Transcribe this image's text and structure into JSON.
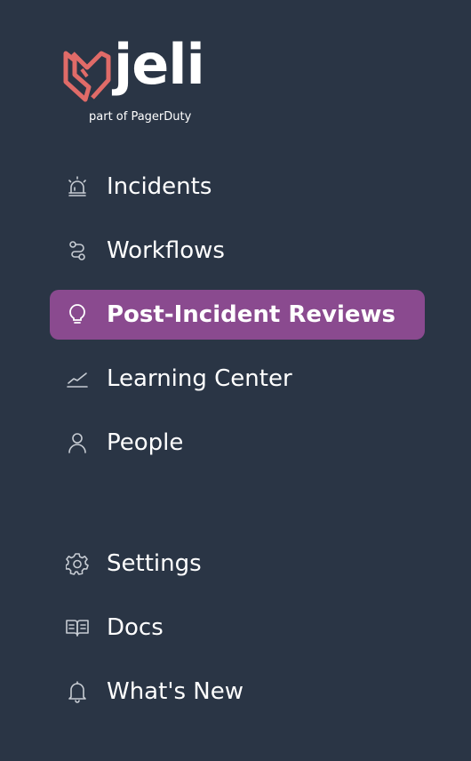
{
  "brand": {
    "name": "jeli",
    "tagline": "part of PagerDuty",
    "logo_color": "#e06b68"
  },
  "colors": {
    "background": "#2a3545",
    "active_item": "#8a4a8f",
    "icon": "#c7ccd3",
    "text": "#ffffff"
  },
  "nav": {
    "primary": [
      {
        "label": "Incidents",
        "icon": "siren-icon",
        "active": false
      },
      {
        "label": "Workflows",
        "icon": "workflow-icon",
        "active": false
      },
      {
        "label": "Post-Incident Reviews",
        "icon": "lightbulb-icon",
        "active": true
      },
      {
        "label": "Learning Center",
        "icon": "chart-line-icon",
        "active": false
      },
      {
        "label": "People",
        "icon": "person-icon",
        "active": false
      }
    ],
    "secondary": [
      {
        "label": "Settings",
        "icon": "gear-icon",
        "active": false
      },
      {
        "label": "Docs",
        "icon": "book-icon",
        "active": false
      },
      {
        "label": "What's New",
        "icon": "bell-icon",
        "active": false
      }
    ]
  }
}
